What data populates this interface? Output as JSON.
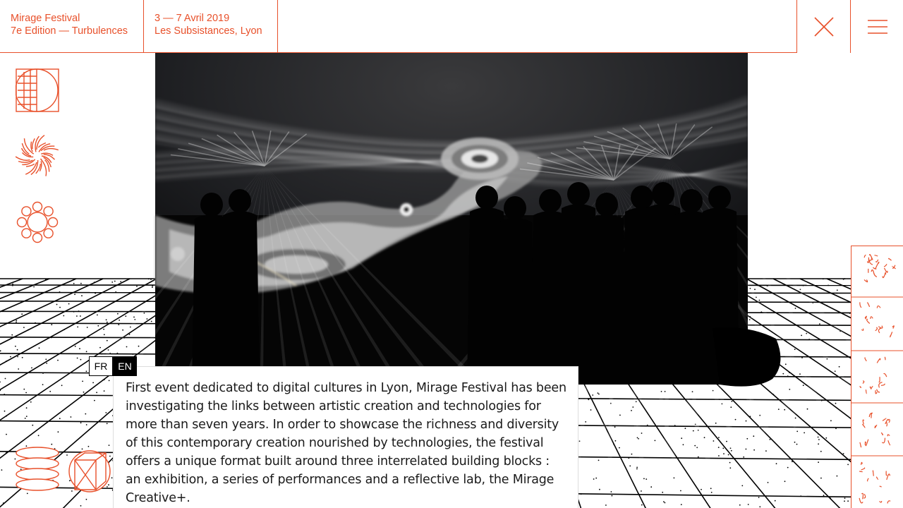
{
  "header": {
    "festival_name": "Mirage Festival",
    "edition": "7e Edition — Turbulences",
    "dates": "3 — 7 Avril 2019",
    "venue": "Les Subsistances, Lyon"
  },
  "colors": {
    "accent": "#e8502a",
    "text": "#1a1a1a",
    "background": "#ffffff"
  },
  "icons": {
    "close": "close-icon",
    "menu": "hamburger-icon",
    "left": [
      "half-circle-grid-icon",
      "spiral-burst-icon",
      "ring-of-circles-icon",
      "stacked-ellipses-icon",
      "cube-circle-icon"
    ]
  },
  "language": {
    "fr": "FR",
    "en": "EN",
    "active": "EN"
  },
  "description": "First event dedicated to digital cultures in Lyon, Mirage Festival has been investigating the links between artistic creation and technologies for more than seven years. In order to showcase the richness and diversity of this contemporary creation nourished by technologies, the festival offers a unique format built around three interrelated building blocks : an exhibition, a series of performances and a reflective lab, the Mirage Creative+."
}
